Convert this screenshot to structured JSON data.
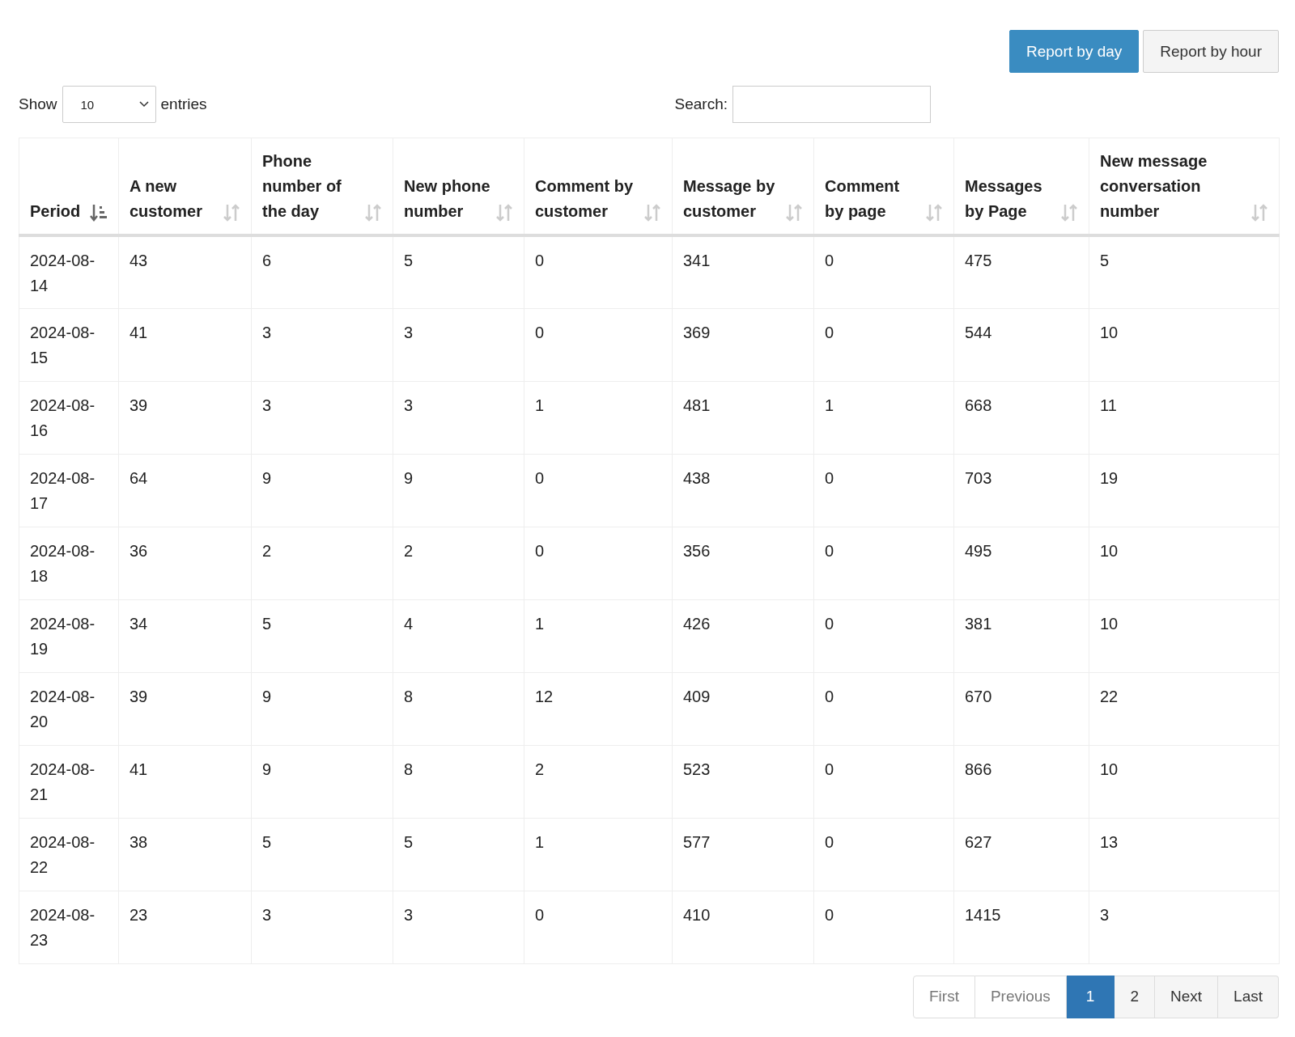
{
  "report_buttons": [
    {
      "label": "Report by day",
      "selected": true
    },
    {
      "label": "Report by hour",
      "selected": false
    }
  ],
  "length_control": {
    "label_before": "Show",
    "value": "10",
    "label_after": "entries"
  },
  "search": {
    "label": "Search:"
  },
  "table": {
    "columns": [
      {
        "label": "Period",
        "sorted": true
      },
      {
        "label": "A new customer",
        "sorted": false
      },
      {
        "label": "Phone number of the day",
        "sorted": false
      },
      {
        "label": "New phone number",
        "sorted": false
      },
      {
        "label": "Comment by customer",
        "sorted": false
      },
      {
        "label": "Message by customer",
        "sorted": false
      },
      {
        "label": "Comment by page",
        "sorted": false
      },
      {
        "label": "Messages by Page",
        "sorted": false
      },
      {
        "label": "New message conversation number",
        "sorted": false
      }
    ],
    "rows": [
      [
        "2024-08-14",
        "43",
        "6",
        "5",
        "0",
        "341",
        "0",
        "475",
        "5"
      ],
      [
        "2024-08-15",
        "41",
        "3",
        "3",
        "0",
        "369",
        "0",
        "544",
        "10"
      ],
      [
        "2024-08-16",
        "39",
        "3",
        "3",
        "1",
        "481",
        "1",
        "668",
        "11"
      ],
      [
        "2024-08-17",
        "64",
        "9",
        "9",
        "0",
        "438",
        "0",
        "703",
        "19"
      ],
      [
        "2024-08-18",
        "36",
        "2",
        "2",
        "0",
        "356",
        "0",
        "495",
        "10"
      ],
      [
        "2024-08-19",
        "34",
        "5",
        "4",
        "1",
        "426",
        "0",
        "381",
        "10"
      ],
      [
        "2024-08-20",
        "39",
        "9",
        "8",
        "12",
        "409",
        "0",
        "670",
        "22"
      ],
      [
        "2024-08-21",
        "41",
        "9",
        "8",
        "2",
        "523",
        "0",
        "866",
        "10"
      ],
      [
        "2024-08-22",
        "38",
        "5",
        "5",
        "1",
        "577",
        "0",
        "627",
        "13"
      ],
      [
        "2024-08-23",
        "23",
        "3",
        "3",
        "0",
        "410",
        "0",
        "1415",
        "3"
      ]
    ]
  },
  "pagination": [
    {
      "label": "First",
      "selected": false,
      "disabled": true
    },
    {
      "label": "Previous",
      "selected": false,
      "disabled": true
    },
    {
      "label": "1",
      "selected": true,
      "disabled": false
    },
    {
      "label": "2",
      "selected": false,
      "disabled": false
    },
    {
      "label": "Next",
      "selected": false,
      "disabled": false
    },
    {
      "label": "Last",
      "selected": false,
      "disabled": false
    }
  ]
}
